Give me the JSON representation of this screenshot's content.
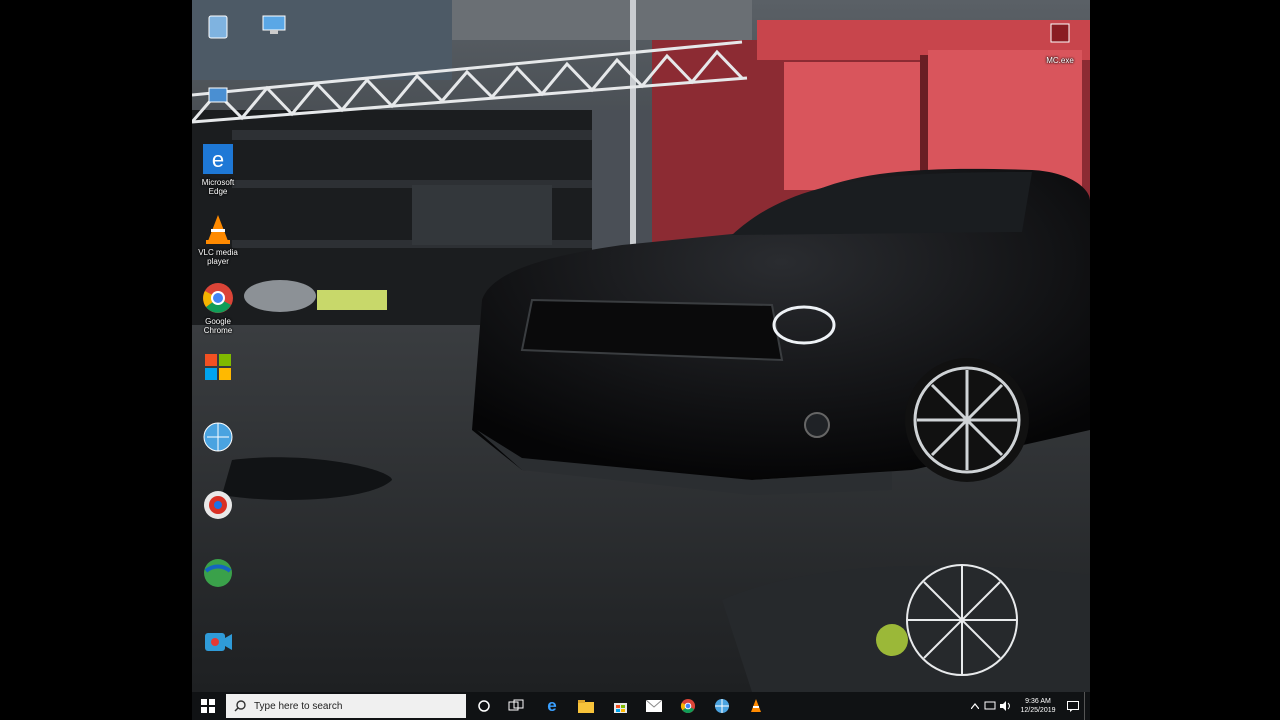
{
  "desktop_icons": [
    {
      "id": "edge",
      "label": "Microsoft Edge"
    },
    {
      "id": "vlc",
      "label": "VLC media player"
    },
    {
      "id": "chrome",
      "label": "Google Chrome"
    },
    {
      "id": "app4",
      "label": ""
    },
    {
      "id": "app5",
      "label": ""
    },
    {
      "id": "app6",
      "label": ""
    },
    {
      "id": "app7",
      "label": ""
    },
    {
      "id": "app8",
      "label": ""
    }
  ],
  "top_right_icon": {
    "label": "MC.exe"
  },
  "taskbar": {
    "search_placeholder": "Type here to search",
    "clock_time": "9:36 AM",
    "clock_date": "12/25/2019"
  },
  "colors": {
    "taskbar": "#101214",
    "accent": "#0078d7"
  }
}
